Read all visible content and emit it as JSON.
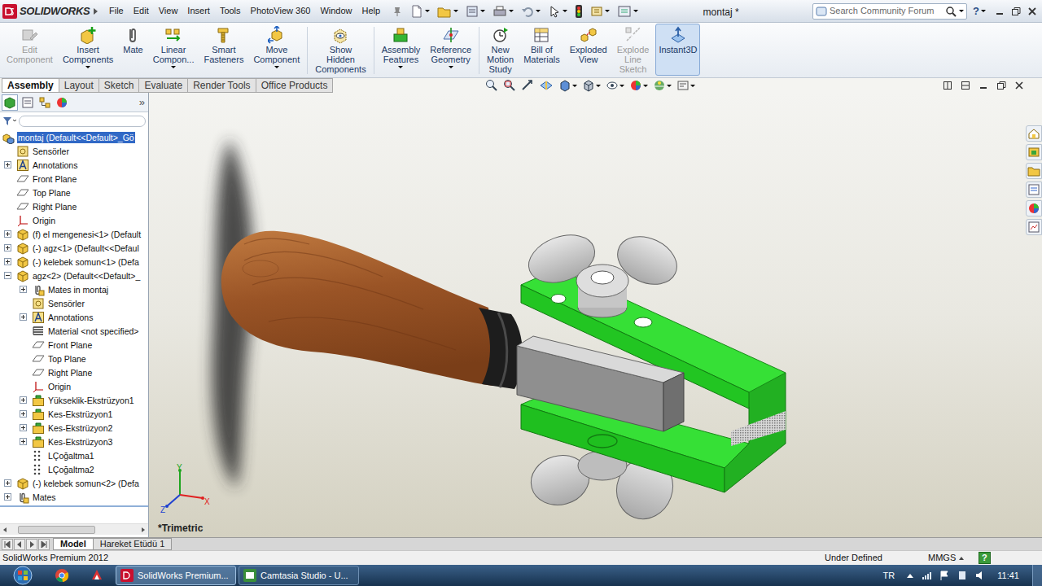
{
  "app": {
    "logo": "SOLIDWORKS",
    "title": "montaj *"
  },
  "menu": [
    "File",
    "Edit",
    "View",
    "Insert",
    "Tools",
    "PhotoView 360",
    "Window",
    "Help"
  ],
  "search": {
    "placeholder": "Search Community Forum"
  },
  "help_button": "?",
  "command_manager": [
    {
      "lines": [
        "Edit",
        "Component"
      ],
      "disabled": true,
      "selected": false,
      "has_menu": false,
      "separator_before": false
    },
    {
      "lines": [
        "Insert",
        "Components"
      ],
      "disabled": false,
      "selected": false,
      "has_menu": true,
      "separator_before": false
    },
    {
      "lines": [
        "Mate"
      ],
      "disabled": false,
      "selected": false,
      "has_menu": false,
      "separator_before": false
    },
    {
      "lines": [
        "Linear",
        "Compon..."
      ],
      "disabled": false,
      "selected": false,
      "has_menu": true,
      "separator_before": false
    },
    {
      "lines": [
        "Smart",
        "Fasteners"
      ],
      "disabled": false,
      "selected": false,
      "has_menu": false,
      "separator_before": false
    },
    {
      "lines": [
        "Move",
        "Component"
      ],
      "disabled": false,
      "selected": false,
      "has_menu": true,
      "separator_before": false
    },
    {
      "lines": [
        "Show",
        "Hidden",
        "Components"
      ],
      "disabled": false,
      "selected": false,
      "has_menu": false,
      "separator_before": true
    },
    {
      "lines": [
        "Assembly",
        "Features"
      ],
      "disabled": false,
      "selected": false,
      "has_menu": true,
      "separator_before": true
    },
    {
      "lines": [
        "Reference",
        "Geometry"
      ],
      "disabled": false,
      "selected": false,
      "has_menu": true,
      "separator_before": false
    },
    {
      "lines": [
        "New",
        "Motion",
        "Study"
      ],
      "disabled": false,
      "selected": false,
      "has_menu": false,
      "separator_before": true
    },
    {
      "lines": [
        "Bill of",
        "Materials"
      ],
      "disabled": false,
      "selected": false,
      "has_menu": false,
      "separator_before": false
    },
    {
      "lines": [
        "Exploded",
        "View"
      ],
      "disabled": false,
      "selected": false,
      "has_menu": false,
      "separator_before": false
    },
    {
      "lines": [
        "Explode",
        "Line",
        "Sketch"
      ],
      "disabled": true,
      "selected": false,
      "has_menu": false,
      "separator_before": false
    },
    {
      "lines": [
        "Instant3D"
      ],
      "disabled": false,
      "selected": true,
      "has_menu": false,
      "separator_before": false
    }
  ],
  "tabs": [
    {
      "label": "Assembly",
      "selected": true
    },
    {
      "label": "Layout",
      "selected": false
    },
    {
      "label": "Sketch",
      "selected": false
    },
    {
      "label": "Evaluate",
      "selected": false
    },
    {
      "label": "Render Tools",
      "selected": false
    },
    {
      "label": "Office Products",
      "selected": false
    }
  ],
  "feature_tree": {
    "more": "»",
    "items": [
      {
        "label": "montaj  (Default<<Default>_Gö",
        "depth": 0,
        "kind": "assembly",
        "expandable": false,
        "expanded": true,
        "selected": true
      },
      {
        "label": "Sensörler",
        "depth": 1,
        "kind": "sensor",
        "expandable": false,
        "expanded": false,
        "selected": false
      },
      {
        "label": "Annotations",
        "depth": 1,
        "kind": "annotation",
        "expandable": true,
        "expanded": false,
        "selected": false
      },
      {
        "label": "Front Plane",
        "depth": 1,
        "kind": "plane",
        "expandable": false,
        "expanded": false,
        "selected": false
      },
      {
        "label": "Top Plane",
        "depth": 1,
        "kind": "plane",
        "expandable": false,
        "expanded": false,
        "selected": false
      },
      {
        "label": "Right Plane",
        "depth": 1,
        "kind": "plane",
        "expandable": false,
        "expanded": false,
        "selected": false
      },
      {
        "label": "Origin",
        "depth": 1,
        "kind": "origin",
        "expandable": false,
        "expanded": false,
        "selected": false
      },
      {
        "label": "(f) el mengenesi<1> (Default",
        "depth": 1,
        "kind": "part",
        "expandable": true,
        "expanded": false,
        "selected": false
      },
      {
        "label": "(-) agz<1> (Default<<Defaul",
        "depth": 1,
        "kind": "part",
        "expandable": true,
        "expanded": false,
        "selected": false
      },
      {
        "label": "(-) kelebek somun<1> (Defa",
        "depth": 1,
        "kind": "part",
        "expandable": true,
        "expanded": false,
        "selected": false
      },
      {
        "label": "agz<2> (Default<<Default>_",
        "depth": 1,
        "kind": "part",
        "expandable": true,
        "expanded": true,
        "selected": false
      },
      {
        "label": "Mates in montaj",
        "depth": 2,
        "kind": "mates",
        "expandable": true,
        "expanded": false,
        "selected": false
      },
      {
        "label": "Sensörler",
        "depth": 2,
        "kind": "sensor",
        "expandable": false,
        "expanded": false,
        "selected": false
      },
      {
        "label": "Annotations",
        "depth": 2,
        "kind": "annotation",
        "expandable": true,
        "expanded": false,
        "selected": false
      },
      {
        "label": "Material <not specified>",
        "depth": 2,
        "kind": "material",
        "expandable": false,
        "expanded": false,
        "selected": false
      },
      {
        "label": "Front Plane",
        "depth": 2,
        "kind": "plane",
        "expandable": false,
        "expanded": false,
        "selected": false
      },
      {
        "label": "Top Plane",
        "depth": 2,
        "kind": "plane",
        "expandable": false,
        "expanded": false,
        "selected": false
      },
      {
        "label": "Right Plane",
        "depth": 2,
        "kind": "plane",
        "expandable": false,
        "expanded": false,
        "selected": false
      },
      {
        "label": "Origin",
        "depth": 2,
        "kind": "origin",
        "expandable": false,
        "expanded": false,
        "selected": false
      },
      {
        "label": "Yükseklik-Ekstrüzyon1",
        "depth": 2,
        "kind": "feature",
        "expandable": true,
        "expanded": false,
        "selected": false
      },
      {
        "label": "Kes-Ekstrüzyon1",
        "depth": 2,
        "kind": "feature",
        "expandable": true,
        "expanded": false,
        "selected": false
      },
      {
        "label": "Kes-Ekstrüzyon2",
        "depth": 2,
        "kind": "feature",
        "expandable": true,
        "expanded": false,
        "selected": false
      },
      {
        "label": "Kes-Ekstrüzyon3",
        "depth": 2,
        "kind": "feature",
        "expandable": true,
        "expanded": false,
        "selected": false
      },
      {
        "label": "LÇoğaltma1",
        "depth": 2,
        "kind": "pattern",
        "expandable": false,
        "expanded": false,
        "selected": false
      },
      {
        "label": "LÇoğaltma2",
        "depth": 2,
        "kind": "pattern",
        "expandable": false,
        "expanded": false,
        "selected": false
      },
      {
        "label": "(-) kelebek somun<2> (Defa",
        "depth": 1,
        "kind": "part",
        "expandable": true,
        "expanded": false,
        "selected": false
      },
      {
        "label": "Mates",
        "depth": 1,
        "kind": "mates",
        "expandable": true,
        "expanded": false,
        "selected": false
      }
    ]
  },
  "viewport": {
    "view_name": "*Trimetric",
    "axes": [
      {
        "label": "Y",
        "color": "#1fa51f"
      },
      {
        "label": "X",
        "color": "#e02020"
      },
      {
        "label": "Z",
        "color": "#2040d0"
      }
    ]
  },
  "bottom_tabs": [
    {
      "label": "Model",
      "selected": true
    },
    {
      "label": "Hareket Etüdü 1",
      "selected": false
    }
  ],
  "status_bar": {
    "product": "SolidWorks Premium 2012",
    "state": "Under Defined",
    "units": "MMGS",
    "help": "?"
  },
  "taskbar": {
    "windows": [
      {
        "label": "SolidWorks Premium...",
        "selected": true
      },
      {
        "label": "Camtasia Studio - U...",
        "selected": false
      }
    ],
    "language": "TR",
    "time": "11:41"
  }
}
